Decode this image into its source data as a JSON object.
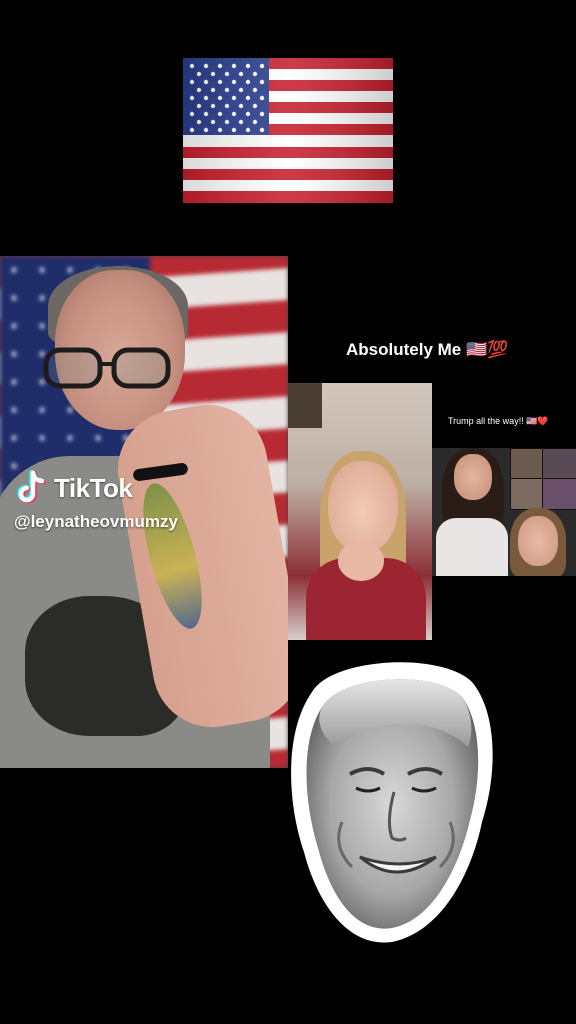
{
  "stickers": {
    "top_flag": "us-flag-emoji-icon",
    "face": "smiling-face-cutout"
  },
  "main_video": {
    "watermark": {
      "brand": "TikTok",
      "handle": "@leynatheovmumzy"
    }
  },
  "caption": {
    "text": "Absolutely Me 🇺🇸💯"
  },
  "collage": {
    "caption": "Trump all the way!! 🇺🇸❤️"
  },
  "colors": {
    "background": "#000000",
    "flag_red": "#b72a33",
    "flag_blue": "#1f2d6b",
    "tiktok_cyan": "#25f4ee",
    "tiktok_pink": "#fe2c55"
  }
}
